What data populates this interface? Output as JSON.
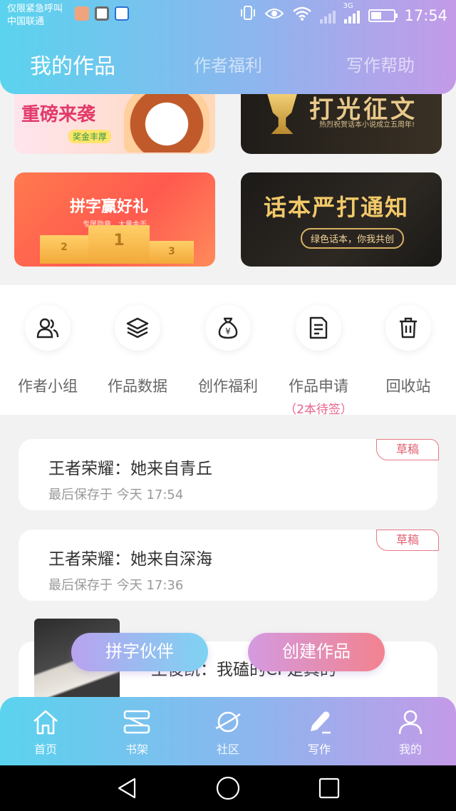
{
  "status_bar": {
    "carrier_line1": "仅限紧急呼叫",
    "carrier_line2": "中国联通",
    "network": "3G",
    "time": "17:54"
  },
  "header": {
    "tabs": [
      {
        "label": "我的作品",
        "active": true
      },
      {
        "label": "作者福利",
        "active": false
      },
      {
        "label": "写作帮助",
        "active": false
      }
    ]
  },
  "banners": {
    "top_left": {
      "headline": "重磅来袭",
      "tag": "奖金丰厚"
    },
    "top_right": {
      "headline": "打光征文",
      "subtitle": "热烈祝贺话本小说成立五周年!"
    },
    "bottom_left": {
      "headline": "拼字赢好礼",
      "subtitle": "专属勋章，大量金币",
      "podium": [
        "2",
        "1",
        "3"
      ]
    },
    "bottom_right": {
      "headline": "话本严打通知",
      "pill": "绿色话本，你我共创"
    }
  },
  "actions": [
    {
      "label": "作者小组",
      "icon": "group-icon"
    },
    {
      "label": "作品数据",
      "icon": "layers-icon"
    },
    {
      "label": "创作福利",
      "icon": "money-bag-icon"
    },
    {
      "label": "作品申请",
      "note": "（2本待签）",
      "icon": "document-icon"
    },
    {
      "label": "回收站",
      "icon": "trash-icon"
    }
  ],
  "works": [
    {
      "title": "王者荣耀：她来自青丘",
      "meta": "最后保存于 今天 17:54",
      "tag": "草稿"
    },
    {
      "title": "王者荣耀：她来自深海",
      "meta": "最后保存于 今天 17:36",
      "tag": "草稿"
    },
    {
      "title": "王俊凯：我磕的CP是真的"
    }
  ],
  "floating_buttons": {
    "partner": "拼字伙伴",
    "create": "创建作品"
  },
  "bottom_nav": [
    {
      "label": "首页",
      "icon": "home-icon"
    },
    {
      "label": "书架",
      "icon": "bookshelf-icon"
    },
    {
      "label": "社区",
      "icon": "planet-icon"
    },
    {
      "label": "写作",
      "icon": "pen-icon",
      "active": true
    },
    {
      "label": "我的",
      "icon": "profile-icon"
    }
  ],
  "colors": {
    "gradient_start": "#5ad3ee",
    "gradient_end": "#c49ae8",
    "draft_tag": "#e25f6f",
    "note_pink": "#e9628a"
  }
}
